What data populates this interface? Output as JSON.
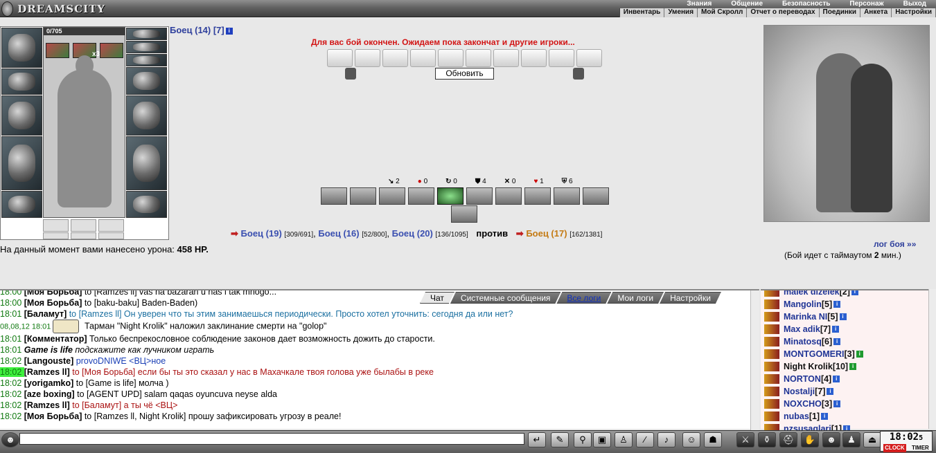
{
  "logo": "DREAMSCITY",
  "top_menu": [
    "Знания",
    "Общение",
    "Безопасность",
    "Персонаж",
    "Выход"
  ],
  "sub_menu": [
    "Инвентарь",
    "Умения",
    "Мой Скролл",
    "Отчет о переводах",
    "Поединки",
    "Анкета",
    "Настройки"
  ],
  "inventory": {
    "hp": "0/705",
    "buff_count": "x3"
  },
  "boss": {
    "name": "Боец (14) [7]"
  },
  "battle_message": "Для вас бой окончен. Ожидаем пока закончат и другие игроки...",
  "refresh_label": "Обновить",
  "stats": [
    {
      "icon": "sword-icon",
      "value": "2"
    },
    {
      "icon": "blood-icon",
      "value": "0"
    },
    {
      "icon": "dodge-icon",
      "value": "0"
    },
    {
      "icon": "block-icon",
      "value": "4"
    },
    {
      "icon": "cross-icon",
      "value": "0"
    },
    {
      "icon": "heart-icon",
      "value": "1"
    },
    {
      "icon": "shield-icon",
      "value": "6"
    }
  ],
  "stat_glyphs": [
    "↘",
    "●",
    "↻",
    "⛊",
    "✕",
    "♥",
    "⛨"
  ],
  "fight": {
    "left": [
      {
        "name": "Боец (19)",
        "hp": "[309/691]"
      },
      {
        "name": "Боец (16)",
        "hp": "[52/800]"
      },
      {
        "name": "Боец (20)",
        "hp": "[136/1095]"
      }
    ],
    "vs": "против",
    "right": {
      "name": "Боец (17)",
      "hp": "[162/1381]"
    }
  },
  "damage_text": "На данный момент вами нанесено урона:",
  "damage_value": "458 HP.",
  "battle_log_link": "лог боя »»",
  "timeout_text": "(Бой идет с таймаутом",
  "timeout_value": "2",
  "timeout_unit": "мин.)",
  "chat_tabs": [
    "Чат",
    "Системные сообщения",
    "Все логи",
    "Мои логи",
    "Настройки"
  ],
  "chat": [
    {
      "time": "18:00",
      "who": "[Моя Борьба]",
      "to": " to [Ramzes ll] vas na bazaran u nas i tak mnogo...",
      "style": "normal"
    },
    {
      "time": "18:00",
      "who": "[Моя Борьба]",
      "to": " to [baku-baku] Baden-Baden)",
      "style": "normal"
    },
    {
      "time": "18:01",
      "who": "[Баламут]",
      "to": " to [Ramzes ll] Он уверен что ты этим занимаешься периодически. Просто хотел уточнить: сегодня да или нет?",
      "style": "teal"
    },
    {
      "time": "08,08,12 18:01",
      "who": "",
      "to": " Тарман \"Night Krolik\" наложил заклинание смерти на \"golop\"",
      "style": "system"
    },
    {
      "time": "18:01",
      "who": "[Комментатор]",
      "to": " Только беспрекословное соблюдение законов дает возможность дожить до старости.",
      "style": "normal"
    },
    {
      "time": "18:01",
      "who": "Game is life",
      "to": " подскажите как лучником играть",
      "style": "italic"
    },
    {
      "time": "18:02",
      "who": "[Langouste]",
      "to": " provoDNIWE <ВЦ>ное",
      "style": "blue"
    },
    {
      "time": "18:02",
      "who": "[Ramzes ll]",
      "to": " to [Моя Борьба] если бы ты это сказал у нас в Махачкале твоя голова уже былабы в реке",
      "style": "red"
    },
    {
      "time": "18:02",
      "who": "[yorigamko]",
      "to": " to [Game is life] молча )",
      "style": "normal"
    },
    {
      "time": "18:02",
      "who": "[aze boxing]",
      "to": " to [AGENT UPD] salam qaqas oyuncuva neyse alda",
      "style": "normal"
    },
    {
      "time": "18:02",
      "who": "[Ramzes ll]",
      "to": " to [Баламут] а ты чё <ВЦ>",
      "style": "darkred"
    },
    {
      "time": "18:02",
      "who": "[Моя Борьба]",
      "to": " to [Ramzes ll, Night Krolik] прошу зафиксировать угрозу в реале!",
      "style": "normal"
    }
  ],
  "users": [
    {
      "name": "malek dizelek",
      "level": "[2]"
    },
    {
      "name": "Mangolin",
      "level": "[5]"
    },
    {
      "name": "Marinka NI",
      "level": "[5]"
    },
    {
      "name": "Max adik",
      "level": "[7]"
    },
    {
      "name": "Minatosq",
      "level": "[6]"
    },
    {
      "name": "MONTGOMERI",
      "level": "[3]"
    },
    {
      "name": "Night Krolik",
      "level": "[10]"
    },
    {
      "name": "NORTON",
      "level": "[4]"
    },
    {
      "name": "Nostalji",
      "level": "[7]"
    },
    {
      "name": "NOXCHO",
      "level": "[3]"
    },
    {
      "name": "nubas",
      "level": "[1]"
    },
    {
      "name": "nzsusaqlari",
      "level": "[1]"
    }
  ],
  "clock": {
    "time": "18:02",
    "sec": "5",
    "label_clock": "CLOCK",
    "label_timer": "TIMER"
  }
}
